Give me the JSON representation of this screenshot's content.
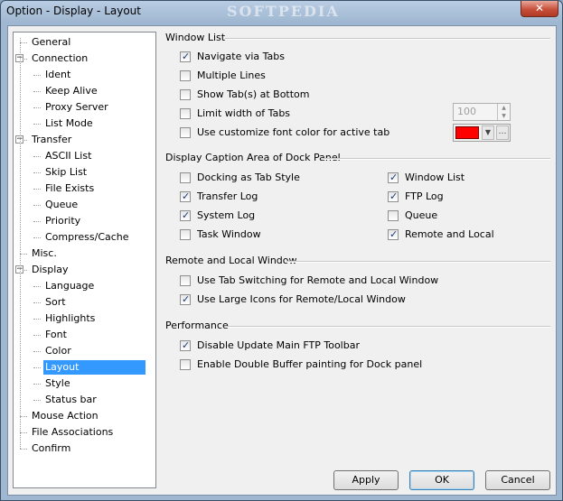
{
  "window": {
    "title": "Option - Display - Layout",
    "watermark": "SOFTPEDIA",
    "close_glyph": "✕"
  },
  "tree": {
    "items": [
      {
        "label": "General",
        "level": 0
      },
      {
        "label": "Connection",
        "level": 0,
        "expander": "−"
      },
      {
        "label": "Ident",
        "level": 1
      },
      {
        "label": "Keep Alive",
        "level": 1
      },
      {
        "label": "Proxy Server",
        "level": 1
      },
      {
        "label": "List Mode",
        "level": 1
      },
      {
        "label": "Transfer",
        "level": 0,
        "expander": "−"
      },
      {
        "label": "ASCII List",
        "level": 1
      },
      {
        "label": "Skip List",
        "level": 1
      },
      {
        "label": "File Exists",
        "level": 1
      },
      {
        "label": "Queue",
        "level": 1
      },
      {
        "label": "Priority",
        "level": 1
      },
      {
        "label": "Compress/Cache",
        "level": 1
      },
      {
        "label": "Misc.",
        "level": 0
      },
      {
        "label": "Display",
        "level": 0,
        "expander": "−"
      },
      {
        "label": "Language",
        "level": 1
      },
      {
        "label": "Sort",
        "level": 1
      },
      {
        "label": "Highlights",
        "level": 1
      },
      {
        "label": "Font",
        "level": 1
      },
      {
        "label": "Color",
        "level": 1
      },
      {
        "label": "Layout",
        "level": 1,
        "selected": true
      },
      {
        "label": "Style",
        "level": 1
      },
      {
        "label": "Status bar",
        "level": 1
      },
      {
        "label": "Mouse Action",
        "level": 0
      },
      {
        "label": "File Associations",
        "level": 0
      },
      {
        "label": "Confirm",
        "level": 0
      }
    ]
  },
  "window_list": {
    "title": "Window List",
    "navigate_via_tabs": {
      "label": "Navigate via Tabs",
      "checked": true
    },
    "multiple_lines": {
      "label": "Multiple Lines",
      "checked": false
    },
    "show_tabs_bottom": {
      "label": "Show Tab(s) at Bottom",
      "checked": false
    },
    "limit_width": {
      "label": "Limit width of Tabs",
      "checked": false,
      "value": "100"
    },
    "customize_font_color": {
      "label": "Use customize font color for active tab",
      "checked": false,
      "color": "#ff0000"
    }
  },
  "dock_panel": {
    "title": "Display Caption Area of Dock Panel",
    "left": [
      {
        "label": "Docking as Tab Style",
        "checked": false
      },
      {
        "label": "Transfer Log",
        "checked": true
      },
      {
        "label": "System Log",
        "checked": true
      },
      {
        "label": "Task Window",
        "checked": false
      }
    ],
    "right": [
      {
        "label": "Window List",
        "checked": true
      },
      {
        "label": "FTP Log",
        "checked": true
      },
      {
        "label": "Queue",
        "checked": false
      },
      {
        "label": "Remote and Local",
        "checked": true
      }
    ]
  },
  "remote_local": {
    "title": "Remote and Local Window",
    "tab_switching": {
      "label": "Use Tab Switching for Remote and Local Window",
      "checked": false
    },
    "large_icons": {
      "label": "Use Large Icons for Remote/Local Window",
      "checked": true
    }
  },
  "performance": {
    "title": "Performance",
    "disable_toolbar": {
      "label": "Disable Update Main FTP Toolbar",
      "checked": true
    },
    "double_buffer": {
      "label": "Enable Double Buffer painting for Dock panel",
      "checked": false
    }
  },
  "buttons": {
    "apply": "Apply",
    "ok": "OK",
    "cancel": "Cancel"
  }
}
